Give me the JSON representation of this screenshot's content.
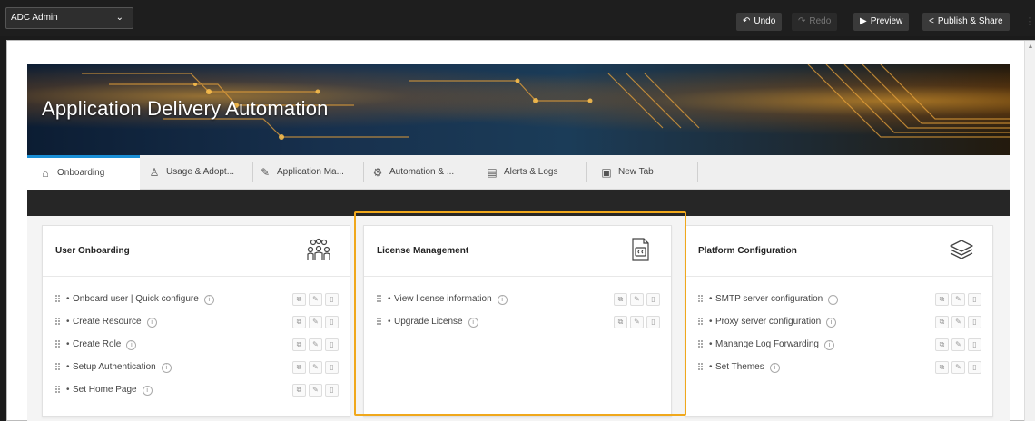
{
  "topbar": {
    "selector_value": "ADC Admin",
    "undo_label": "Undo",
    "redo_label": "Redo",
    "preview_label": "Preview",
    "publish_label": "Publish & Share"
  },
  "banner": {
    "title": "Application Delivery Automation"
  },
  "tabs": [
    {
      "label": "Onboarding",
      "icon": "home-icon"
    },
    {
      "label": "Usage & Adopt...",
      "icon": "chart-icon"
    },
    {
      "label": "Application Ma...",
      "icon": "edit-icon"
    },
    {
      "label": "Automation & ...",
      "icon": "gear-icon"
    },
    {
      "label": "Alerts & Logs",
      "icon": "log-icon"
    },
    {
      "label": "New Tab",
      "icon": "tab-icon"
    }
  ],
  "cards": [
    {
      "title": "User Onboarding",
      "icon": "users-icon",
      "items": [
        "Onboard user | Quick configure",
        "Create Resource",
        "Create Role",
        "Setup Authentication",
        "Set Home Page"
      ]
    },
    {
      "title": "License Management",
      "icon": "license-icon",
      "items": [
        "View license information",
        "Upgrade License"
      ]
    },
    {
      "title": "Platform Configuration",
      "icon": "layers-icon",
      "items": [
        "SMTP server configuration",
        "Proxy server configuration",
        "Manange Log Forwarding",
        "Set Themes"
      ]
    }
  ],
  "colors": {
    "highlight": "#f0a81c",
    "active_tab": "#1a8fd6"
  }
}
